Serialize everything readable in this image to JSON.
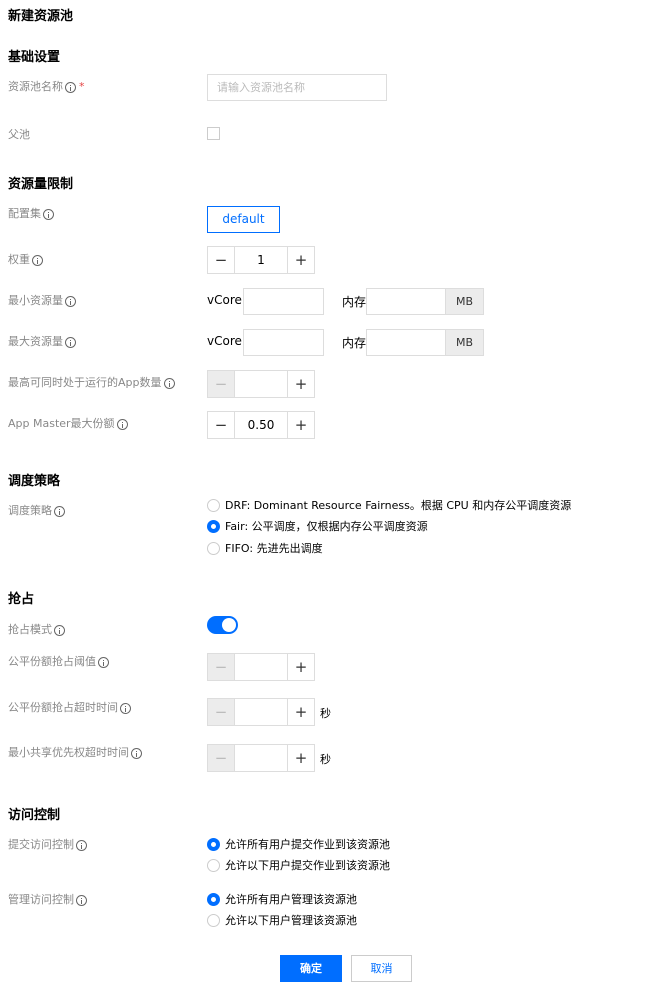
{
  "page": {
    "title": "新建资源池"
  },
  "basic": {
    "section_title": "基础设置",
    "name_label": "资源池名称",
    "name_required": "*",
    "name_placeholder": "请输入资源池名称",
    "parent_label": "父池"
  },
  "limits": {
    "section_title": "资源量限制",
    "config_label": "配置集",
    "config_value": "default",
    "weight_label": "权重",
    "weight_value": "1",
    "min_label": "最小资源量",
    "max_label": "最大资源量",
    "vcore_label": "vCore",
    "memory_label": "内存",
    "memory_unit": "MB",
    "max_apps_label": "最高可同时处于运行的App数量",
    "max_apps_value": "",
    "am_share_label": "App Master最大份额",
    "am_share_value": "0.50"
  },
  "scheduling": {
    "section_title": "调度策略",
    "policy_label": "调度策略",
    "options": [
      {
        "label": "DRF: Dominant Resource Fairness。根据 CPU 和内存公平调度资源",
        "selected": false
      },
      {
        "label": "Fair: 公平调度，仅根据内存公平调度资源",
        "selected": true
      },
      {
        "label": "FIFO: 先进先出调度",
        "selected": false
      }
    ]
  },
  "preemption": {
    "section_title": "抢占",
    "mode_label": "抢占模式",
    "mode_enabled": true,
    "fair_threshold_label": "公平份额抢占阈值",
    "fair_timeout_label": "公平份额抢占超时时间",
    "min_share_timeout_label": "最小共享优先权超时时间",
    "seconds_unit": "秒",
    "fair_threshold_value": "",
    "fair_timeout_value": "",
    "min_share_timeout_value": ""
  },
  "access": {
    "section_title": "访问控制",
    "submit_label": "提交访问控制",
    "submit_options": [
      {
        "label": "允许所有用户提交作业到该资源池",
        "selected": true
      },
      {
        "label": "允许以下用户提交作业到该资源池",
        "selected": false
      }
    ],
    "manage_label": "管理访问控制",
    "manage_options": [
      {
        "label": "允许所有用户管理该资源池",
        "selected": true
      },
      {
        "label": "允许以下用户管理该资源池",
        "selected": false
      }
    ]
  },
  "footer": {
    "ok_label": "确定",
    "cancel_label": "取消"
  },
  "colors": {
    "primary": "#006eff",
    "required": "#e54545",
    "label": "#888888"
  },
  "icons": {
    "info": "info-circle-icon",
    "minus": "−",
    "plus": "+"
  }
}
